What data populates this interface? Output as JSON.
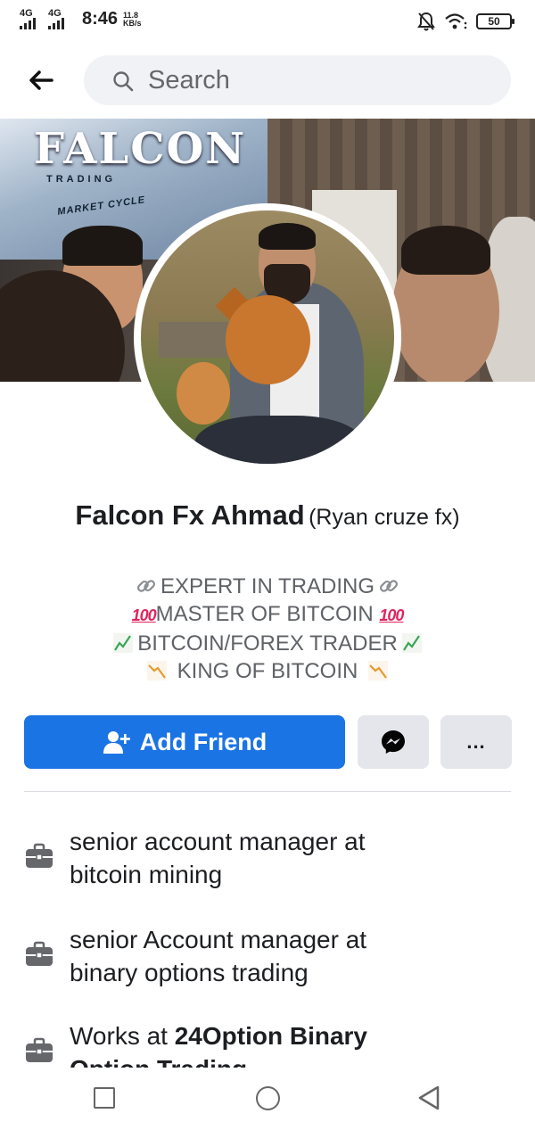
{
  "status_bar": {
    "net1": "4G",
    "net2": "4G",
    "time": "8:46",
    "speed_value": "11.8",
    "speed_unit": "KB/s",
    "battery": "50",
    "icons": [
      "mute-icon",
      "wifi-icon",
      "battery-icon"
    ]
  },
  "topbar": {
    "back_icon": "arrow-left-icon",
    "search_placeholder": "Search"
  },
  "cover": {
    "logo_text": "FALCON",
    "logo_sub": "TRADING",
    "screen_caption": "MARKET CYCLE"
  },
  "profile": {
    "name": "Falcon Fx Ahmad",
    "alternate_name": "(Ryan cruze fx)"
  },
  "bio": {
    "line1": "EXPERT IN TRADING",
    "line2": "MASTER OF BITCOIN",
    "line3": "BITCOIN/FOREX TRADER",
    "line4": "KING OF BITCOIN",
    "hundred_mark": "100"
  },
  "actions": {
    "add_friend_label": "Add Friend",
    "message_icon": "messenger-icon",
    "more_icon": "more-dots-icon",
    "more_label": "..."
  },
  "work": {
    "items": [
      {
        "line1": "senior account manager at",
        "line2": "bitcoin mining"
      },
      {
        "line1": "senior Account manager at",
        "line2": "binary options trading"
      },
      {
        "prefix": "Works at ",
        "bold1": "24Option Binary",
        "bold2": "Option Trading"
      }
    ]
  },
  "colors": {
    "primary": "#1b74e4",
    "secondary_button": "#e4e6eb",
    "search_bg": "#f0f2f5",
    "bio_text": "#5f6266"
  },
  "navbar": {
    "icons": [
      "recents-square-icon",
      "home-circle-icon",
      "back-triangle-icon"
    ]
  }
}
